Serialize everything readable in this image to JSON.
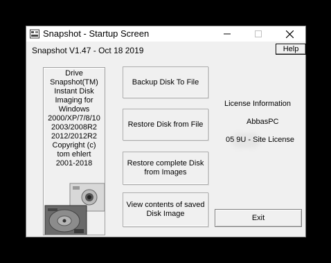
{
  "window": {
    "title": "Snapshot - Startup Screen",
    "controls": {
      "minimize": "minimize-icon",
      "maximize": "maximize-icon",
      "close": "close-icon"
    }
  },
  "header": {
    "version": "Snapshot V1.47 - Oct 18 2019",
    "help_label": "Help"
  },
  "info_panel": {
    "text": "Drive\nSnapshot(TM)\nInstant Disk\nImaging for\nWindows\n2000/XP/7/8/10\n2003/2008R2\n2012/2012R2\nCopyright (c)\ntom ehlert\n2001-2018"
  },
  "actions": [
    {
      "label": "Backup Disk To File"
    },
    {
      "label": "Restore Disk from File"
    },
    {
      "label": "Restore complete Disk\nfrom Images"
    },
    {
      "label": "View contents of saved\nDisk Image"
    }
  ],
  "license": {
    "title": "License Information",
    "name": "AbbasPC",
    "key": "05    9U - Site License"
  },
  "exit_label": "Exit"
}
